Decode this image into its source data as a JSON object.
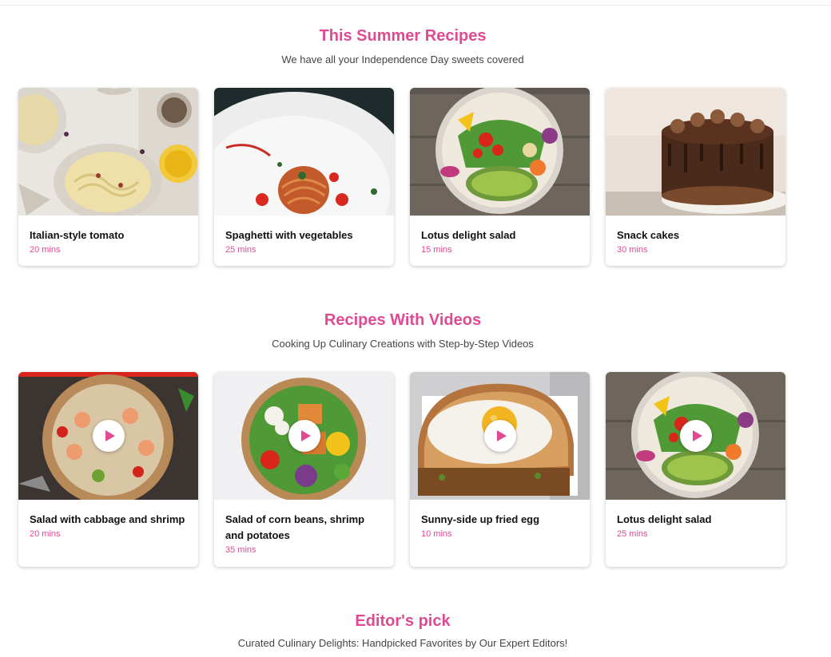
{
  "colors": {
    "accent": "#e04a93",
    "text": "#111111",
    "subtext": "#444444"
  },
  "summer": {
    "title": "This Summer Recipes",
    "subtitle": "We have all your Independence Day sweets covered",
    "cards": [
      {
        "title": "Italian-style tomato",
        "time": "20 mins"
      },
      {
        "title": "Spaghetti with vegetables",
        "time": "25 mins"
      },
      {
        "title": "Lotus delight salad",
        "time": "15 mins"
      },
      {
        "title": "Snack cakes",
        "time": "30 mins"
      }
    ]
  },
  "videos": {
    "title": "Recipes With Videos",
    "subtitle": "Cooking Up Culinary Creations with Step-by-Step Videos",
    "cards": [
      {
        "title": "Salad with cabbage and shrimp",
        "time": "20 mins",
        "icon": "play-icon"
      },
      {
        "title": "Salad of corn beans, shrimp and potatoes",
        "time": "35 mins",
        "icon": "play-icon"
      },
      {
        "title": "Sunny-side up fried egg",
        "time": "10 mins",
        "icon": "play-icon"
      },
      {
        "title": "Lotus delight salad",
        "time": "25 mins",
        "icon": "play-icon"
      }
    ]
  },
  "editors": {
    "title": "Editor's pick",
    "subtitle": "Curated Culinary Delights: Handpicked Favorites by Our Expert Editors!"
  }
}
